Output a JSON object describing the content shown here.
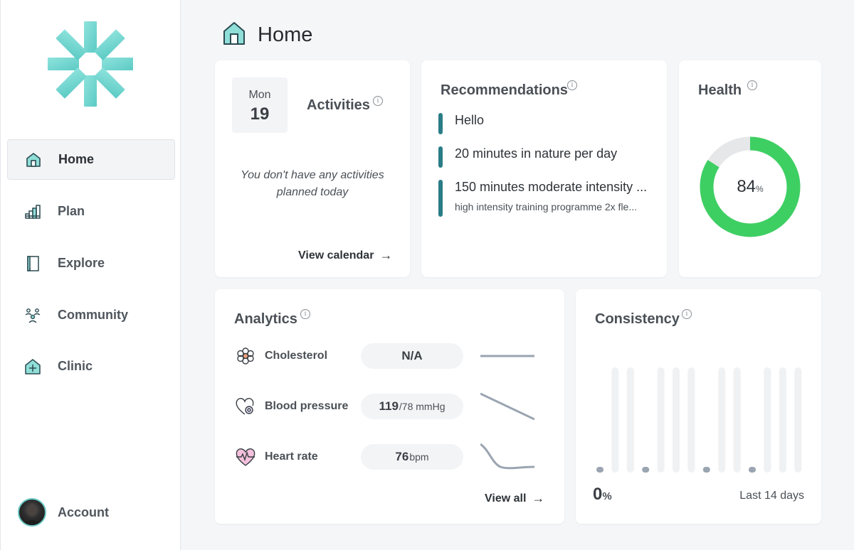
{
  "nav": {
    "items": [
      {
        "label": "Home",
        "icon": "home-icon"
      },
      {
        "label": "Plan",
        "icon": "plan-icon"
      },
      {
        "label": "Explore",
        "icon": "explore-icon"
      },
      {
        "label": "Community",
        "icon": "community-icon"
      },
      {
        "label": "Clinic",
        "icon": "clinic-icon"
      }
    ],
    "active": "Home",
    "account_label": "Account"
  },
  "header": {
    "title": "Home"
  },
  "activities": {
    "day_of_week": "Mon",
    "day_of_month": "19",
    "title": "Activities",
    "empty_line1": "You don't have any activities",
    "empty_line2": "planned today",
    "link_label": "View calendar"
  },
  "recommendations": {
    "title": "Recommendations",
    "items": [
      {
        "main": "Hello",
        "sub": ""
      },
      {
        "main": "20 minutes in nature per day",
        "sub": ""
      },
      {
        "main": "150 minutes moderate intensity ...",
        "sub": "high intensity training programme 2x fle..."
      }
    ]
  },
  "health": {
    "title": "Health",
    "value": "84",
    "unit": "%",
    "fraction": 0.84,
    "ring_color": "#3ecf63",
    "track_color": "#e6e7e9"
  },
  "analytics": {
    "title": "Analytics",
    "metrics": [
      {
        "name": "Cholesterol",
        "value": "N/A",
        "unit": "",
        "icon": "flower-icon",
        "trend": "flat"
      },
      {
        "name": "Blood pressure",
        "value": "119",
        "unit": "/78 mmHg",
        "icon": "heart-pulse-icon",
        "trend": "down"
      },
      {
        "name": "Heart rate",
        "value": "76",
        "unit": " bpm",
        "icon": "heartbeat-icon",
        "trend": "drop-then-flat"
      }
    ],
    "link_label": "View all"
  },
  "consistency": {
    "title": "Consistency",
    "value": "0",
    "unit": "%",
    "period_label": "Last 14 days",
    "days": [
      0,
      0,
      0,
      0,
      0,
      0,
      0,
      0,
      0,
      0,
      0,
      0,
      0,
      0
    ],
    "dot_days": [
      0,
      3,
      7,
      10
    ]
  },
  "colors": {
    "accent": "#2a7d87",
    "teal_light": "#7fd6d2",
    "health_green": "#3ecf63"
  }
}
